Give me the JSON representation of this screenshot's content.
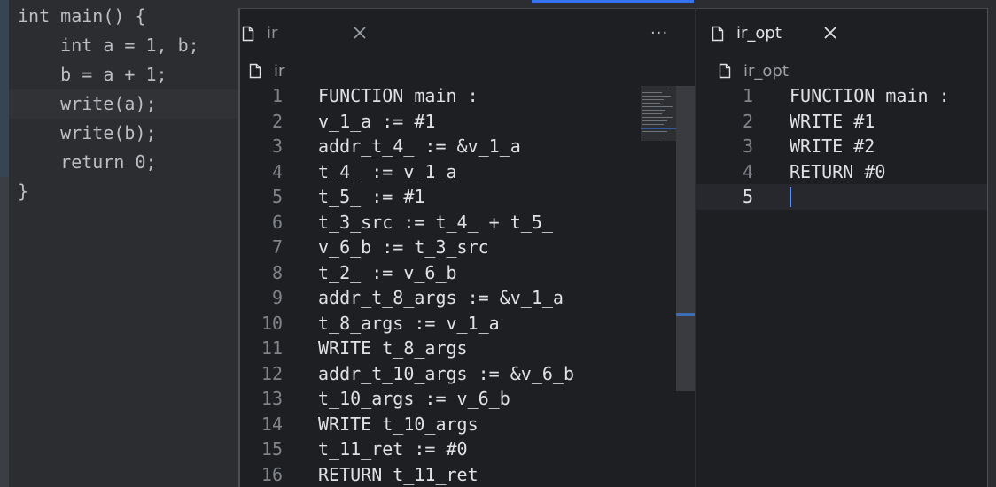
{
  "source": {
    "lines": [
      "int main() {",
      "    int a = 1, b;",
      "    b = a + 1;",
      "    write(a);",
      "    write(b);",
      "    return 0;",
      "}"
    ]
  },
  "ir_panel": {
    "tab_label": "ir",
    "breadcrumb": "ir",
    "more_label": "···",
    "lines": [
      {
        "num": "1",
        "text": "FUNCTION main :"
      },
      {
        "num": "2",
        "text": "v_1_a := #1"
      },
      {
        "num": "3",
        "text": "addr_t_4_ := &v_1_a"
      },
      {
        "num": "4",
        "text": "t_4_ := v_1_a"
      },
      {
        "num": "5",
        "text": "t_5_ := #1"
      },
      {
        "num": "6",
        "text": "t_3_src := t_4_ + t_5_"
      },
      {
        "num": "7",
        "text": "v_6_b := t_3_src"
      },
      {
        "num": "8",
        "text": "t_2_ := v_6_b"
      },
      {
        "num": "9",
        "text": "addr_t_8_args := &v_1_a"
      },
      {
        "num": "10",
        "text": "t_8_args := v_1_a"
      },
      {
        "num": "11",
        "text": "WRITE t_8_args"
      },
      {
        "num": "12",
        "text": "addr_t_10_args := &v_6_b"
      },
      {
        "num": "13",
        "text": "t_10_args := v_6_b"
      },
      {
        "num": "14",
        "text": "WRITE t_10_args"
      },
      {
        "num": "15",
        "text": "t_11_ret := #0"
      },
      {
        "num": "16",
        "text": "RETURN t_11_ret"
      }
    ]
  },
  "opt_panel": {
    "tab_label": "ir_opt",
    "breadcrumb": "ir_opt",
    "lines": [
      {
        "num": "1",
        "text": "FUNCTION main :"
      },
      {
        "num": "2",
        "text": "WRITE #1"
      },
      {
        "num": "3",
        "text": "WRITE #2"
      },
      {
        "num": "4",
        "text": "RETURN #0"
      },
      {
        "num": "5",
        "text": ""
      }
    ]
  },
  "icons": {
    "file": "file-icon",
    "close": "close-icon",
    "more": "more-icon"
  },
  "colors": {
    "editor_bg": "#1e1f22",
    "background_editor": "#2b2d30",
    "text": "#dfe1e5",
    "line_number": "#7f838a",
    "caret": "#5f8ff7",
    "accent": "#3574f0"
  }
}
